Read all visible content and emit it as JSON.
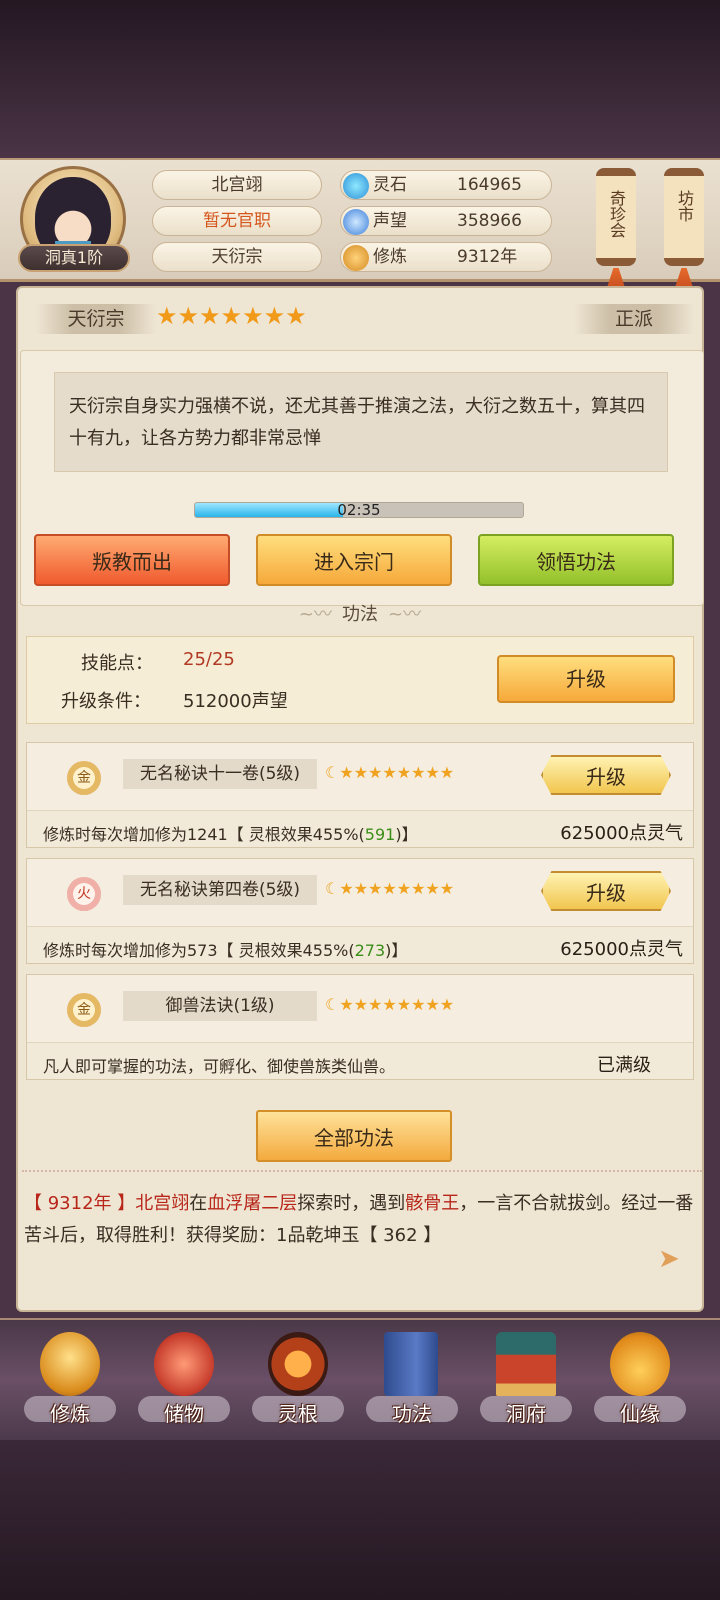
{
  "header": {
    "player_name": "北宫翊",
    "official_title": "暂无官职",
    "sect": "天衍宗",
    "rank": "洞真1阶",
    "stats": [
      {
        "label": "灵石",
        "value": "164965",
        "icon": "spirit-stone-icon"
      },
      {
        "label": "声望",
        "value": "358966",
        "icon": "reputation-icon"
      },
      {
        "label": "修炼",
        "value": "9312年",
        "icon": "cultivation-icon"
      }
    ],
    "scroll_buttons": [
      "奇珍会",
      "坊市"
    ]
  },
  "sect_panel": {
    "sect_name": "天衍宗",
    "star_count": 7,
    "alignment": "正派",
    "description": "天衍宗自身实力强横不说，还尤其善于推演之法，大衍之数五十，算其四十有九，让各方势力都非常忌惮",
    "timer": "02:35",
    "progress": 0.45,
    "buttons": [
      "叛教而出",
      "进入宗门",
      "领悟功法"
    ]
  },
  "gongfa": {
    "section_title": "功法",
    "skill_points_label": "技能点：",
    "skill_points_value": "25/25",
    "upgrade_cond_label": "升级条件：",
    "upgrade_cond_value": "512000声望",
    "upgrade_button": "升级",
    "skills": [
      {
        "medal": "金",
        "name": "无名秘诀十一卷(5级)",
        "desc_pre": "修炼时每次增加修为1241【 灵根效果455%(",
        "desc_green": "591",
        "desc_post": ")】",
        "right": "625000点灵气",
        "button": "升级"
      },
      {
        "medal": "火",
        "name": "无名秘诀第四卷(5级)",
        "desc_pre": "修炼时每次增加修为573【 灵根效果455%(",
        "desc_green": "273",
        "desc_post": ")】",
        "right": "625000点灵气",
        "button": "升级"
      },
      {
        "medal": "金",
        "name": "御兽法诀(1级)",
        "desc_pre": "凡人即可掌握的功法，可孵化、御使兽族类仙兽。",
        "desc_green": "",
        "desc_post": "",
        "right": "已满级",
        "button": ""
      }
    ],
    "all_button": "全部功法"
  },
  "log": {
    "year": "【 9312年 】",
    "player": "北宫翊",
    "text1": "在",
    "location": "血浮屠二层",
    "text2": "探索时，遇到",
    "enemy": "骸骨王",
    "text3": "，一言不合就拔剑。经过一番苦斗后，取得胜利！获得奖励：1品乾坤玉【 362 】"
  },
  "nav": [
    {
      "label": "修炼",
      "icon": "cultivate-monk-icon"
    },
    {
      "label": "储物",
      "icon": "storage-bag-icon"
    },
    {
      "label": "灵根",
      "icon": "spirit-root-icon"
    },
    {
      "label": "功法",
      "icon": "technique-book-icon"
    },
    {
      "label": "洞府",
      "icon": "cave-mansion-icon"
    },
    {
      "label": "仙缘",
      "icon": "gourd-fate-icon"
    }
  ]
}
